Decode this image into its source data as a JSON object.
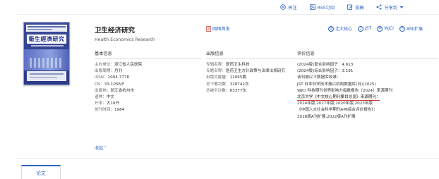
{
  "top_actions": [
    {
      "icon": "plus-circle-icon",
      "label": "关注"
    },
    {
      "icon": "rss-icon",
      "label": "RSS订阅"
    },
    {
      "icon": "edit-icon",
      "label": "投稿"
    },
    {
      "icon": "share-icon",
      "label": "分享到"
    }
  ],
  "journal": {
    "title_cn": "卫生经济研究",
    "title_en": "Health Economics Research",
    "cover_title": "衛生經濟研究",
    "site_link": "网络首发"
  },
  "badges": [
    {
      "mark": "北",
      "label": "北大核心"
    },
    {
      "mark": "J",
      "label": "JST"
    },
    {
      "mark": "W",
      "label": "WJCI"
    },
    {
      "mark": "A",
      "label": "AMI扩展"
    }
  ],
  "basic": {
    "header": "基本信息",
    "rows": [
      {
        "k": "主办单位：",
        "v": "浙江省人民医院"
      },
      {
        "k": "出版周期：",
        "v": "月刊"
      },
      {
        "k": "ISSN：",
        "v": "1004-7778"
      },
      {
        "k": "CN：",
        "v": "33-1056/F"
      },
      {
        "k": "出版地：",
        "v": "浙江省杭州市"
      },
      {
        "k": "语种：",
        "v": "中文"
      },
      {
        "k": "开本：",
        "v": "大16开"
      },
      {
        "k": "创刊时间：",
        "v": "1984"
      }
    ]
  },
  "publish": {
    "header": "出版信息",
    "rows": [
      {
        "k": "专辑名称：",
        "v": "医药卫生科技"
      },
      {
        "k": "专题名称：",
        "v": "医药卫生方针政策与法律法规研究"
      },
      {
        "k": "出版文献量：",
        "v": "11065篇"
      },
      {
        "k": "总下载次数：",
        "v": "328742次"
      },
      {
        "k": "总被引次数：",
        "v": "83377次"
      }
    ]
  },
  "evaluation": {
    "header": "评价信息",
    "lines": [
      "(2024版)复合影响因子：4.613",
      "(2024版)综合影响因子：3.191",
      "该刊被以下数据库收录：",
      "JST 日本科学技术振兴机构数据库(日)(2025)",
      "WJCI 科技期刊世界影响力指数报告（2024）来源期刊"
    ],
    "core_line": "北京大学《中文核心期刊要目总览》来源期刊：",
    "core_years": "2014年版,2017年版,2020年版,2023年版",
    "ami_line": "《中国人文社会科学期刊AMI综合评价报告》：",
    "ami_years": "2018版A刊扩展,2022版A刊扩展"
  },
  "collapse_label": "收起⌃",
  "tab_label": "论文"
}
